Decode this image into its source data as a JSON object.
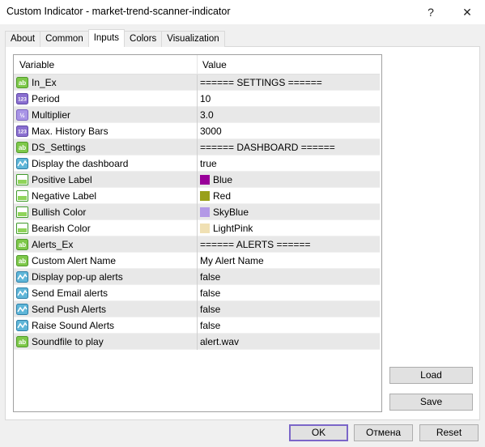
{
  "window": {
    "title": "Custom Indicator - market-trend-scanner-indicator",
    "help_label": "?",
    "close_label": "✕"
  },
  "tabs": [
    {
      "label": "About"
    },
    {
      "label": "Common"
    },
    {
      "label": "Inputs"
    },
    {
      "label": "Colors"
    },
    {
      "label": "Visualization"
    }
  ],
  "grid": {
    "col_variable": "Variable",
    "col_value": "Value",
    "rows": [
      {
        "icon": "ab-icon",
        "name": "In_Ex",
        "value": "====== SETTINGS ======"
      },
      {
        "icon": "integer-icon",
        "name": "Period",
        "value": "10"
      },
      {
        "icon": "double-icon",
        "name": "Multiplier",
        "value": "3.0"
      },
      {
        "icon": "integer-icon",
        "name": "Max. History Bars",
        "value": "3000"
      },
      {
        "icon": "ab-icon",
        "name": "DS_Settings",
        "value": "====== DASHBOARD ======"
      },
      {
        "icon": "bool-icon",
        "name": "Display the dashboard",
        "value": "true"
      },
      {
        "icon": "color-icon",
        "name": "Positive Label",
        "value": "Blue",
        "swatch": "#990099"
      },
      {
        "icon": "color-icon",
        "name": "Negative Label",
        "value": "Red",
        "swatch": "#99a01a"
      },
      {
        "icon": "color-icon",
        "name": "Bullish Color",
        "value": "SkyBlue",
        "swatch": "#b399e6"
      },
      {
        "icon": "color-icon",
        "name": "Bearish Color",
        "value": "LightPink",
        "swatch": "#f0e0b3"
      },
      {
        "icon": "ab-icon",
        "name": "Alerts_Ex",
        "value": "====== ALERTS ======"
      },
      {
        "icon": "ab-icon",
        "name": "Custom Alert Name",
        "value": "My Alert Name"
      },
      {
        "icon": "bool-icon",
        "name": "Display pop-up alerts",
        "value": "false"
      },
      {
        "icon": "bool-icon",
        "name": "Send Email alerts",
        "value": "false"
      },
      {
        "icon": "bool-icon",
        "name": "Send Push Alerts",
        "value": "false"
      },
      {
        "icon": "bool-icon",
        "name": "Raise Sound Alerts",
        "value": "false"
      },
      {
        "icon": "ab-icon",
        "name": "Soundfile to play",
        "value": "alert.wav"
      }
    ]
  },
  "buttons": {
    "load": "Load",
    "save": "Save",
    "ok": "OK",
    "cancel": "Отмена",
    "reset": "Reset"
  }
}
